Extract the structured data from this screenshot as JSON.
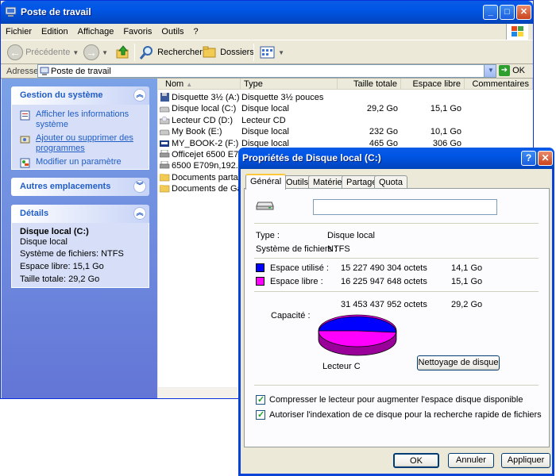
{
  "window": {
    "title": "Poste de travail",
    "controls": {
      "minimize": "_",
      "maximize": "□",
      "close": "✕"
    }
  },
  "menu": [
    "Fichier",
    "Edition",
    "Affichage",
    "Favoris",
    "Outils",
    "?"
  ],
  "toolbar": {
    "back": "Précédente",
    "search": "Rechercher",
    "folders": "Dossiers"
  },
  "address": {
    "label": "Adresse",
    "value": "Poste de travail",
    "go": "OK"
  },
  "taskpane": {
    "system": {
      "title": "Gestion du système",
      "links": [
        "Afficher les informations système",
        "Ajouter ou supprimer des programmes",
        "Modifier un paramètre"
      ]
    },
    "other": {
      "title": "Autres emplacements"
    },
    "details": {
      "title": "Détails",
      "name": "Disque local (C:)",
      "type": "Disque local",
      "fs": "Système de fichiers: NTFS",
      "free": "Espace libre: 15,1 Go",
      "total": "Taille totale: 29,2 Go"
    }
  },
  "filelist": {
    "columns": [
      "Nom",
      "Type",
      "Taille totale",
      "Espace libre",
      "Commentaires"
    ],
    "rows": [
      {
        "name": "Disquette 3½ (A:)",
        "type": "Disquette 3½ pouces",
        "total": "",
        "free": "",
        "icon": "floppy-icon"
      },
      {
        "name": "Disque local (C:)",
        "type": "Disque local",
        "total": "29,2 Go",
        "free": "15,1 Go",
        "icon": "drive-icon"
      },
      {
        "name": "Lecteur CD (D:)",
        "type": "Lecteur CD",
        "total": "",
        "free": "",
        "icon": "cd-icon"
      },
      {
        "name": "My Book (E:)",
        "type": "Disque local",
        "total": "232 Go",
        "free": "10,1 Go",
        "icon": "drive-icon"
      },
      {
        "name": "MY_BOOK-2 (F:)",
        "type": "Disque local",
        "total": "465 Go",
        "free": "306 Go",
        "icon": "wd-drive-icon"
      },
      {
        "name": "Officejet 6500 E7",
        "type": "",
        "total": "",
        "free": "",
        "icon": "printer-icon"
      },
      {
        "name": "6500 E709n,192....",
        "type": "",
        "total": "",
        "free": "",
        "icon": "printer-icon"
      },
      {
        "name": "Documents parta...",
        "type": "",
        "total": "",
        "free": "",
        "icon": "folder-icon"
      },
      {
        "name": "Documents de Ga...",
        "type": "",
        "total": "",
        "free": "",
        "icon": "folder-icon"
      }
    ]
  },
  "dialog": {
    "title": "Propriétés de Disque local (C:)",
    "help": "?",
    "close": "✕",
    "tabs": [
      "Général",
      "Outils",
      "Matériel",
      "Partage",
      "Quota"
    ],
    "name_value": "",
    "type_label": "Type :",
    "type_value": "Disque local",
    "fs_label": "Système de fichiers :",
    "fs_value": "NTFS",
    "used_label": "Espace utilisé :",
    "used_bytes": "15 227 490 304 octets",
    "used_go": "14,1 Go",
    "free_label": "Espace libre :",
    "free_bytes": "16 225 947 648 octets",
    "free_go": "15,1 Go",
    "cap_label": "Capacité :",
    "cap_bytes": "31 453 437 952 octets",
    "cap_go": "29,2 Go",
    "drive_label": "Lecteur C",
    "cleanup": "Nettoyage de disque",
    "compress": "Compresser le lecteur pour augmenter l'espace disque disponible",
    "index": "Autoriser l'indexation de ce disque pour la recherche rapide de fichiers",
    "ok": "OK",
    "cancel": "Annuler",
    "apply": "Appliquer",
    "colors": {
      "used": "#0000FF",
      "free": "#FF00FF"
    },
    "used_fraction": 0.484
  }
}
